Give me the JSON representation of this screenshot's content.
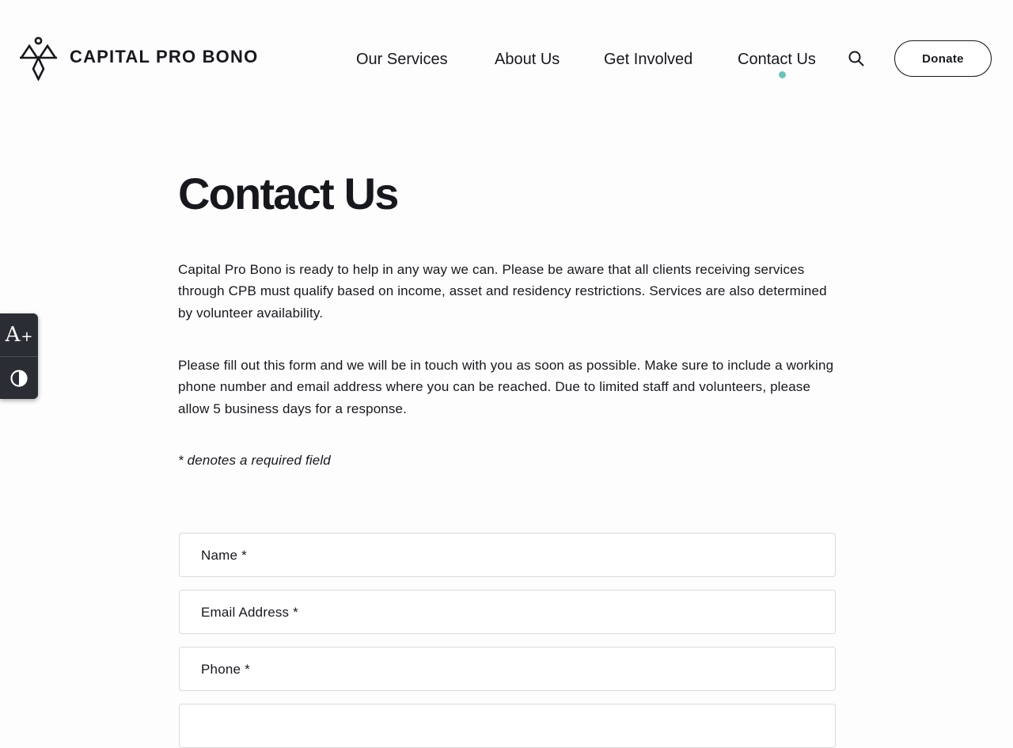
{
  "brand": {
    "name": "CAPITAL PRO BONO",
    "accent_color": "#6cc3b8",
    "text_color": "#16181d"
  },
  "nav": {
    "items": [
      {
        "label": "Our Services"
      },
      {
        "label": "About Us"
      },
      {
        "label": "Get Involved"
      },
      {
        "label": "Contact Us",
        "active": true
      }
    ],
    "search_icon": "search-icon",
    "donate_label": "Donate"
  },
  "accessibility": {
    "font_size_label": "A",
    "font_size_plus": "+",
    "font_size_icon": "font-size-increase-icon",
    "contrast_icon": "contrast-icon"
  },
  "page": {
    "title": "Contact Us",
    "paragraphs": [
      "Capital Pro Bono is ready to help in any way we can. Please be aware that all clients receiving services through CPB must qualify based on income, asset and residency restrictions.  Services are also determined by volunteer availability.",
      "Please fill out this form and we will be in touch with you as soon as possible. Make sure to include a working phone number and email address where you can be reached.  Due to limited staff and volunteers, please allow 5 business days for a response."
    ],
    "required_note": "* denotes a required field"
  },
  "form": {
    "fields": [
      {
        "label": "Name  *",
        "value": ""
      },
      {
        "label": "Email Address  *",
        "value": ""
      },
      {
        "label": "Phone  *",
        "value": ""
      },
      {
        "label": "",
        "value": ""
      }
    ]
  }
}
